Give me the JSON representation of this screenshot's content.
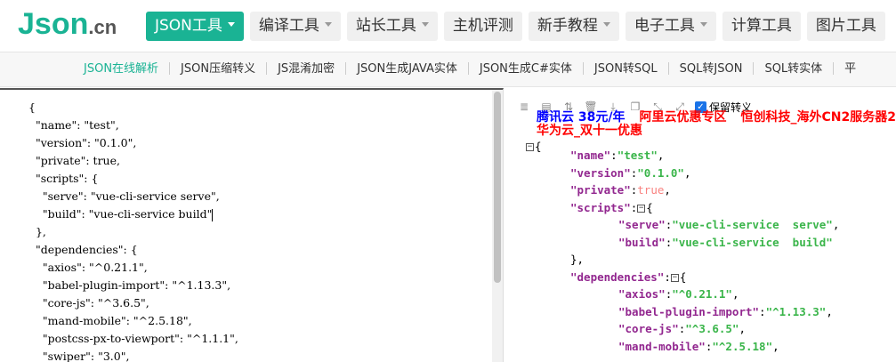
{
  "logo": {
    "main": "Json",
    "suffix": ".cn"
  },
  "nav": [
    {
      "label": "JSON工具",
      "active": true,
      "dropdown": true
    },
    {
      "label": "编译工具",
      "dropdown": true
    },
    {
      "label": "站长工具",
      "dropdown": true
    },
    {
      "label": "主机评测",
      "dropdown": false
    },
    {
      "label": "新手教程",
      "dropdown": true
    },
    {
      "label": "电子工具",
      "dropdown": true
    },
    {
      "label": "计算工具",
      "dropdown": false
    },
    {
      "label": "图片工具",
      "dropdown": false
    }
  ],
  "subnav": [
    {
      "label": "JSON在线解析",
      "active": true
    },
    {
      "label": "JSON压缩转义"
    },
    {
      "label": "JS混淆加密"
    },
    {
      "label": "JSON生成JAVA实体"
    },
    {
      "label": "JSON生成C#实体"
    },
    {
      "label": "JSON转SQL"
    },
    {
      "label": "SQL转JSON"
    },
    {
      "label": "SQL转实体"
    },
    {
      "label": "平"
    }
  ],
  "editor": {
    "lines": [
      "{",
      "  \"name\": \"test\",",
      "  \"version\": \"0.1.0\",",
      "  \"private\": true,",
      "  \"scripts\": {",
      "    \"serve\": \"vue-cli-service serve\",",
      "    \"build\": \"vue-cli-service build\"",
      "  },",
      "  \"dependencies\": {",
      "    \"axios\": \"^0.21.1\",",
      "    \"babel-plugin-import\": \"^1.13.3\",",
      "    \"core-js\": \"^3.6.5\",",
      "    \"mand-mobile\": \"^2.5.18\",",
      "    \"postcss-px-to-viewport\": \"^1.1.1\",",
      "    \"swiper\": \"3.0\","
    ]
  },
  "toolbar": {
    "icons": [
      "database-icon",
      "file-icon",
      "sort-icon",
      "trash-icon",
      "download-icon",
      "copy-icon",
      "compress-icon",
      "expand-icon"
    ],
    "keep_escape_label": "保留转义",
    "keep_escape_checked": true
  },
  "ads": [
    {
      "label": "腾讯云 38元/年",
      "color": "#0000ff"
    },
    {
      "label": "阿里云优惠专区",
      "color": "#ff0000"
    },
    {
      "label": "恒创科技_海外CN2服务器2",
      "color": "#ff0000"
    },
    {
      "label": "华为云_双十一优惠",
      "color": "#ff0000"
    }
  ],
  "tree": [
    {
      "indent": 1,
      "key": "name",
      "value": "\"test\"",
      "vtype": "string",
      "comma": true
    },
    {
      "indent": 1,
      "key": "version",
      "value": "\"0.1.0\"",
      "vtype": "string",
      "comma": true
    },
    {
      "indent": 1,
      "key": "private",
      "value": "true",
      "vtype": "bool",
      "comma": true
    },
    {
      "indent": 1,
      "key": "scripts",
      "open": "{",
      "toggle": true
    },
    {
      "indent": 2,
      "key": "serve",
      "value": "\"vue-cli-service  serve\"",
      "vtype": "string",
      "comma": true
    },
    {
      "indent": 2,
      "key": "build",
      "value": "\"vue-cli-service  build\"",
      "vtype": "string",
      "comma": false
    },
    {
      "indent": 1,
      "close": "},",
      "vtype": "punct"
    },
    {
      "indent": 1,
      "key": "dependencies",
      "open": "{",
      "toggle": true
    },
    {
      "indent": 2,
      "key": "axios",
      "value": "\"^0.21.1\"",
      "vtype": "string",
      "comma": true
    },
    {
      "indent": 2,
      "key": "babel-plugin-import",
      "value": "\"^1.13.3\"",
      "vtype": "string",
      "comma": true
    },
    {
      "indent": 2,
      "key": "core-js",
      "value": "\"^3.6.5\"",
      "vtype": "string",
      "comma": true
    },
    {
      "indent": 2,
      "key": "mand-mobile",
      "value": "\"^2.5.18\"",
      "vtype": "string",
      "comma": true
    }
  ],
  "colors": {
    "brand": "#1ab394",
    "key": "#92278f",
    "string": "#3ab54a",
    "bool": "#f98280"
  }
}
